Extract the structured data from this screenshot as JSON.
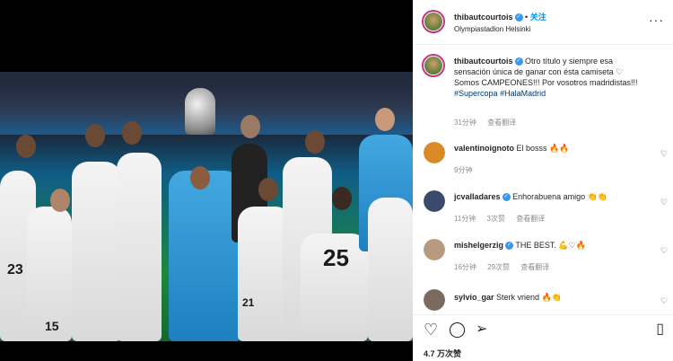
{
  "header": {
    "username": "thibautcourtois",
    "follow_label": "关注",
    "location": "Olympiastadion Helsinki",
    "separator": "•"
  },
  "photo": {
    "jersey_numbers": [
      "23",
      "15",
      "21",
      "25"
    ]
  },
  "caption": {
    "username": "thibautcourtois",
    "line1": "Otro título y siempre esa",
    "line2": "sensación única de ganar con ésta camiseta",
    "line3": "Somos CAMPEONES!!! Por vosotros madridistas!!!",
    "tag1": "#Supercopa",
    "tag2": "#HalaMadrid",
    "time": "31分钟",
    "translate": "查看翻译",
    "heart": "♡"
  },
  "comments": [
    {
      "user": "valentinoignoto",
      "text": "El bosss",
      "emoji": "🔥🔥",
      "time": "9分钟",
      "likes": "",
      "translate": "",
      "color": "#d98a26"
    },
    {
      "user": "jcvalladares",
      "text": "Enhorabuena amigo",
      "emoji": "👏👏",
      "time": "11分钟",
      "likes": "3次赞",
      "translate": "查看翻译",
      "color": "#3a4a6a"
    },
    {
      "user": "mishelgerzig",
      "text": "THE BEST.",
      "emoji": "💪♡🔥",
      "time": "16分钟",
      "likes": "29次赞",
      "translate": "查看翻译",
      "color": "#b89a80"
    },
    {
      "user": "sylvio_gar",
      "text": "Sterk vriend",
      "emoji": "🔥👏",
      "time": "",
      "likes": "",
      "translate": "",
      "color": "#7a6a60"
    }
  ],
  "footer": {
    "likes": "4.7 万次赞"
  }
}
